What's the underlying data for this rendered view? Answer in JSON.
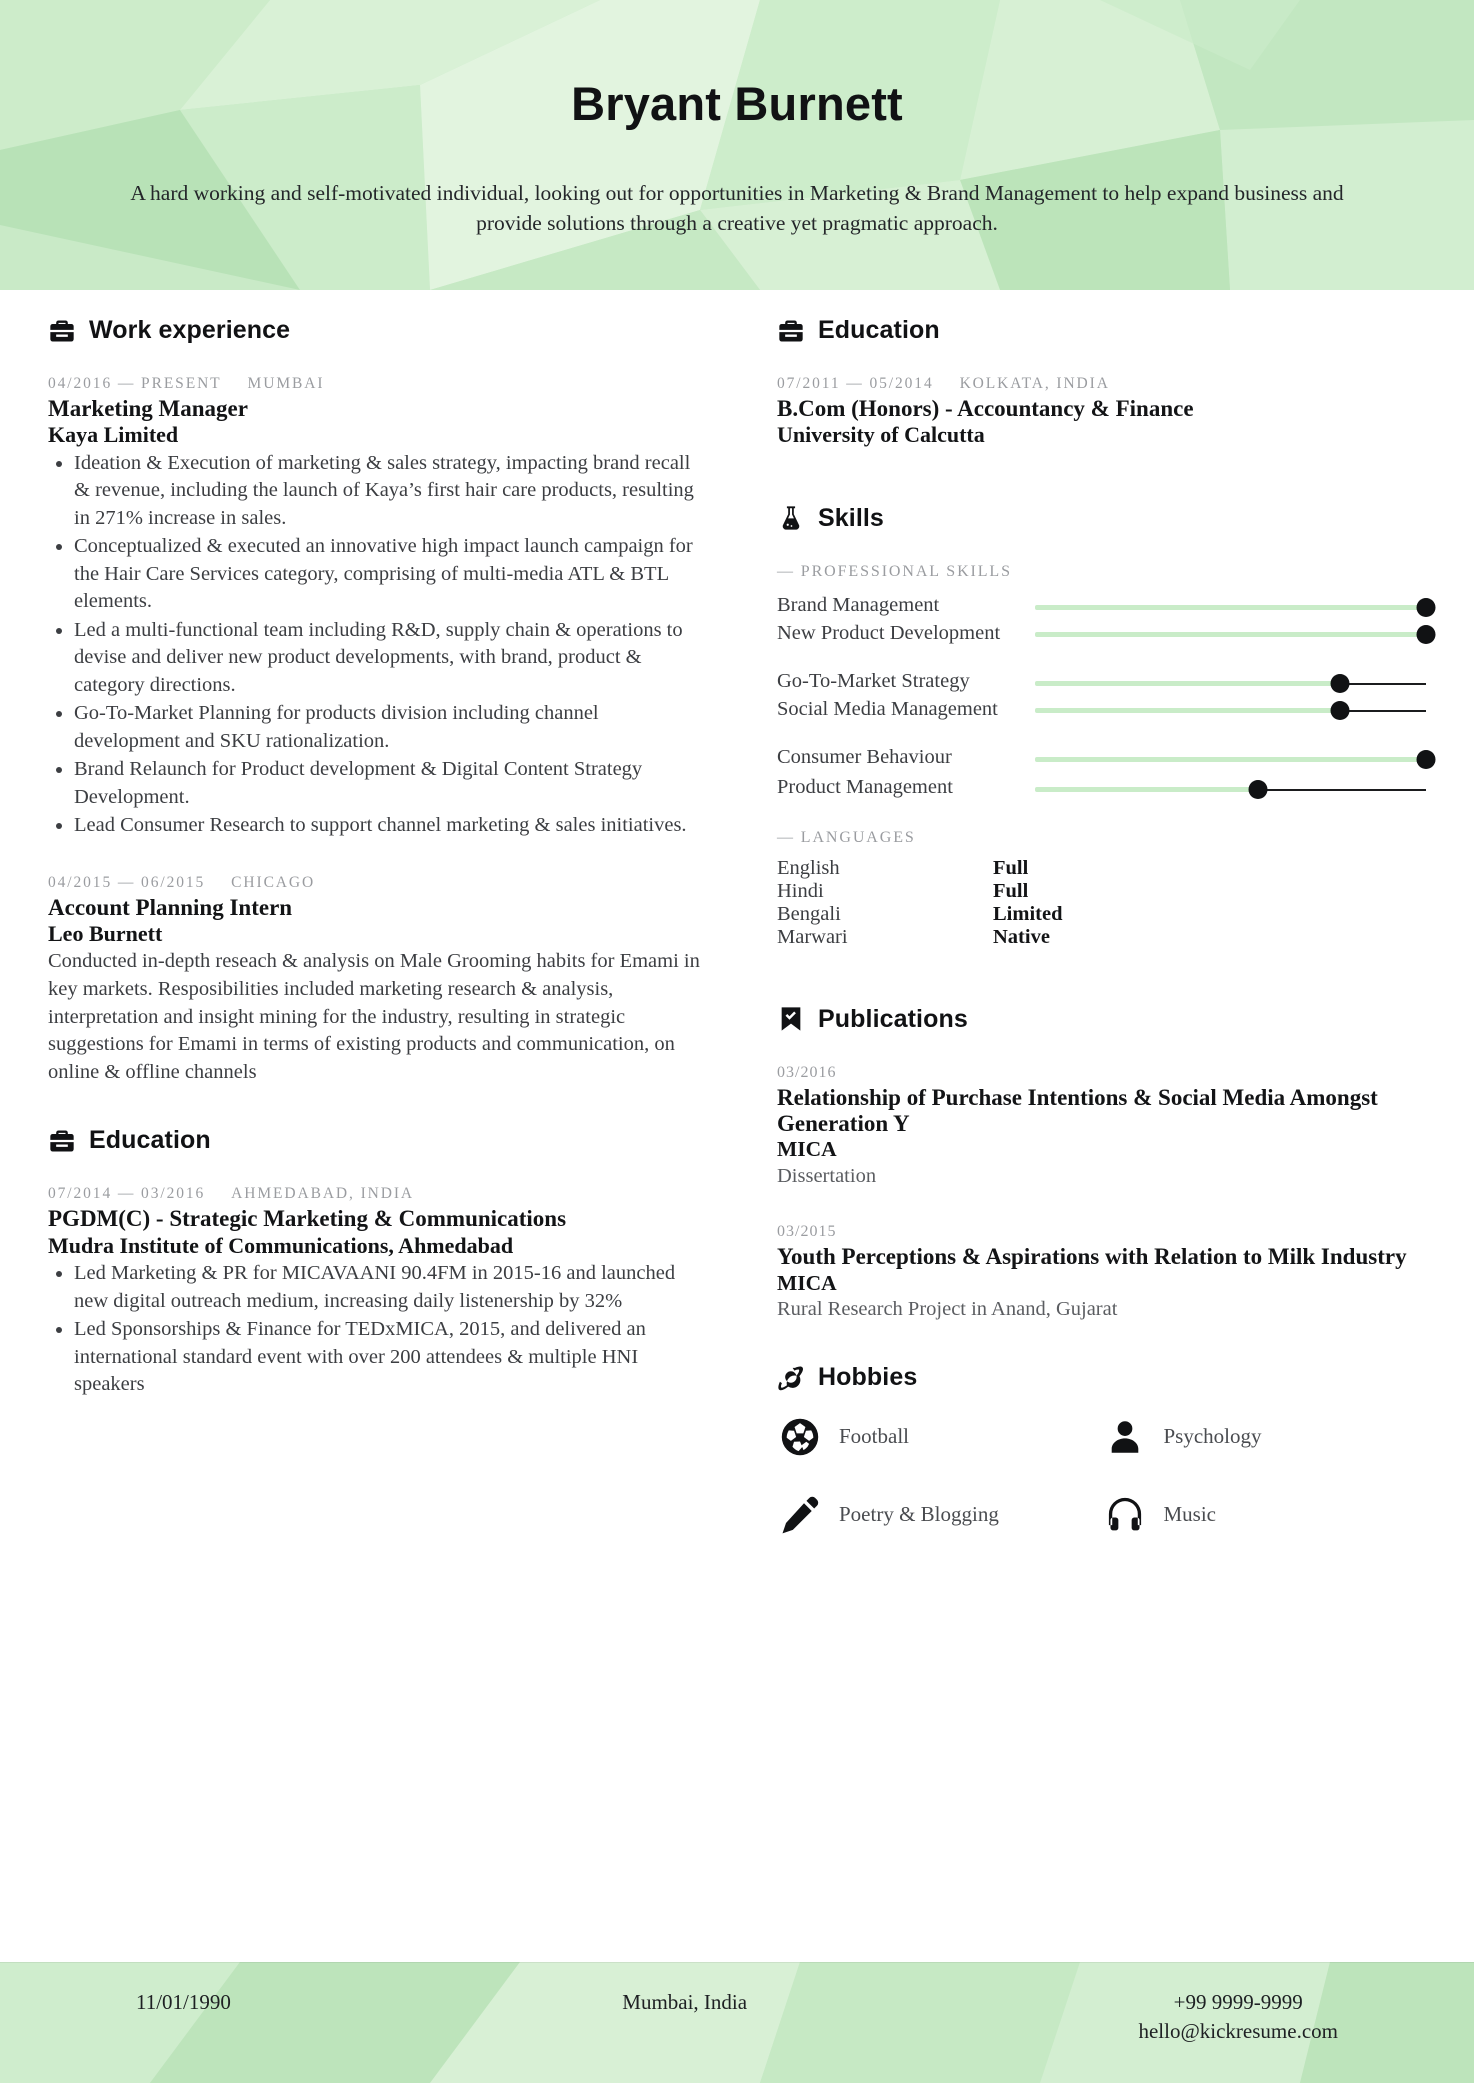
{
  "theme": {
    "accent_green": "#c7e9c6",
    "bar_fill": "#c9ecc8",
    "ink": "#111214",
    "muted": "#9a9ca0"
  },
  "header": {
    "name": "Bryant Burnett",
    "summary": "A hard working and self-motivated individual, looking out for opportunities in Marketing & Brand Management to help expand business and provide solutions through a creative yet pragmatic approach."
  },
  "work_experience": {
    "icon": "briefcase-icon",
    "title": "Work experience",
    "entries": [
      {
        "dates": "04/2016 — PRESENT",
        "location": "MUMBAI",
        "role": "Marketing Manager",
        "org": "Kaya Limited",
        "bullets": [
          "Ideation & Execution of marketing & sales strategy, impacting brand recall & revenue, including the launch of Kaya’s first hair care products, resulting in 271% increase in sales.",
          "Conceptualized & executed an innovative high impact launch campaign for the Hair Care Services category, comprising of multi-media ATL & BTL elements.",
          "Led a multi-functional team including R&D, supply chain & operations to devise and deliver new product developments, with brand, product & category directions.",
          "Go-To-Market Planning for products division including channel development and SKU rationalization.",
          "Brand Relaunch for Product development & Digital Content Strategy Development.",
          "Lead Consumer Research to support channel marketing & sales initiatives."
        ]
      },
      {
        "dates": "04/2015 — 06/2015",
        "location": "CHICAGO",
        "role": "Account Planning Intern",
        "org": "Leo Burnett",
        "paragraph": "Conducted in-depth reseach & analysis on Male Grooming habits for Emami in key markets. Resposibilities included marketing research & analysis, interpretation and insight mining for the industry, resulting in strategic suggestions for Emami in terms of existing products and communication, on online & offline channels"
      }
    ]
  },
  "education_left": {
    "icon": "briefcase-icon",
    "title": "Education",
    "entries": [
      {
        "dates": "07/2014 — 03/2016",
        "location": "AHMEDABAD, INDIA",
        "degree": "PGDM(C) - Strategic Marketing & Communications",
        "school": "Mudra Institute of Communications, Ahmedabad",
        "bullets": [
          "Led Marketing & PR for MICAVAANI 90.4FM in 2015-16 and launched new digital outreach medium, increasing daily listenership by 32%",
          "Led Sponsorships & Finance for TEDxMICA, 2015, and delivered an international standard event with over 200 attendees & multiple HNI speakers"
        ]
      }
    ]
  },
  "education_right": {
    "icon": "briefcase-icon",
    "title": "Education",
    "entries": [
      {
        "dates": "07/2011 — 05/2014",
        "location": "KOLKATA, INDIA",
        "degree": "B.Com (Honors) - Accountancy & Finance",
        "school": "University of Calcutta"
      }
    ]
  },
  "skills": {
    "icon": "flask-icon",
    "title": "Skills",
    "professional_label": "— PROFESSIONAL SKILLS",
    "professional": [
      {
        "name": "Brand Management",
        "level": 100
      },
      {
        "name": "New Product Development",
        "level": 100
      },
      {
        "name": "Go-To-Market Strategy",
        "level": 78
      },
      {
        "name": "Social Media Management",
        "level": 78
      },
      {
        "name": "Consumer Behaviour",
        "level": 100
      },
      {
        "name": "Product Management",
        "level": 57
      }
    ],
    "languages_label": "— LANGUAGES",
    "languages": [
      {
        "name": "English",
        "level": "Full"
      },
      {
        "name": "Hindi",
        "level": "Full"
      },
      {
        "name": "Bengali",
        "level": "Limited"
      },
      {
        "name": "Marwari",
        "level": "Native"
      }
    ]
  },
  "publications": {
    "icon": "bookmark-check-icon",
    "title": "Publications",
    "entries": [
      {
        "date": "03/2016",
        "title": "Relationship of Purchase Intentions & Social Media Amongst Generation Y",
        "org": "MICA",
        "note": "Dissertation"
      },
      {
        "date": "03/2015",
        "title": "Youth Perceptions & Aspirations with Relation to Milk Industry",
        "org": "MICA",
        "note": "Rural Research Project in Anand, Gujarat"
      }
    ]
  },
  "hobbies": {
    "icon": "planet-icon",
    "title": "Hobbies",
    "items": [
      {
        "icon": "football-icon",
        "label": "Football"
      },
      {
        "icon": "person-icon",
        "label": "Psychology"
      },
      {
        "icon": "pencil-icon",
        "label": "Poetry & Blogging"
      },
      {
        "icon": "headphones-icon",
        "label": "Music"
      }
    ]
  },
  "footer": {
    "birthdate": "11/01/1990",
    "location": "Mumbai, India",
    "phone": "+99 9999-9999",
    "email": "hello@kickresume.com"
  }
}
